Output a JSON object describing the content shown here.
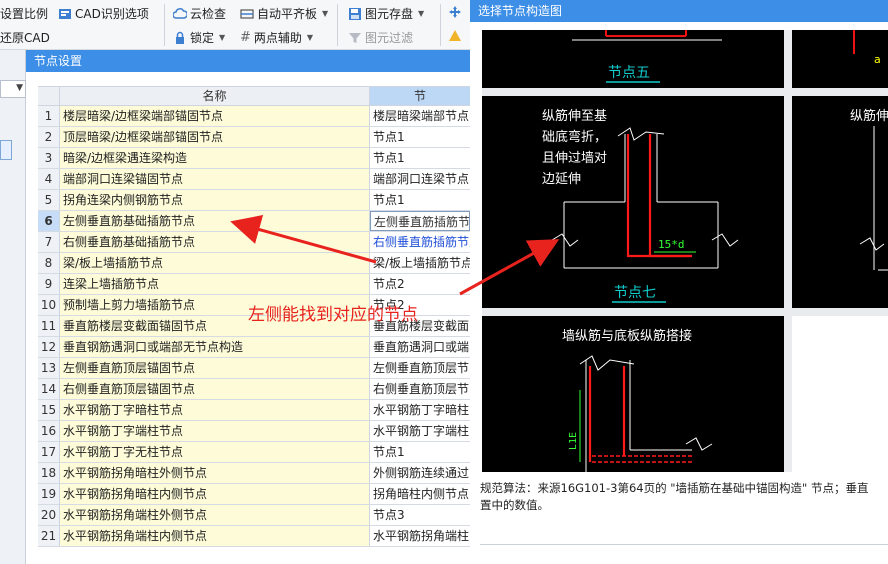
{
  "ribbon": {
    "set_ratio": "设置比例",
    "cad_identify": "CAD识别选项",
    "restore_cad": "还原CAD",
    "cloud_check": "云检查",
    "lock": "锁定",
    "auto_align": "自动平齐板",
    "two_point_aux": "两点辅助",
    "save_element": "图元存盘",
    "element_filter": "图元过滤"
  },
  "node_dialog": {
    "title": "节点设置",
    "col_name": "名称",
    "col_value": "节",
    "rows": [
      {
        "num": "1",
        "name": "楼层暗梁/边框梁端部锚固节点",
        "value": "楼层暗梁端部节点"
      },
      {
        "num": "2",
        "name": "顶层暗梁/边框梁端部锚固节点",
        "value": "节点1"
      },
      {
        "num": "3",
        "name": "暗梁/边框梁遇连梁构造",
        "value": "节点1"
      },
      {
        "num": "4",
        "name": "端部洞口连梁锚固节点",
        "value": "端部洞口连梁节点"
      },
      {
        "num": "5",
        "name": "拐角连梁内侧钢筋节点",
        "value": "节点1"
      },
      {
        "num": "6",
        "name": "左侧垂直筋基础插筋节点",
        "value": "左侧垂直筋插筋节点"
      },
      {
        "num": "7",
        "name": "右侧垂直筋基础插筋节点",
        "value": "右侧垂直筋插筋节点"
      },
      {
        "num": "8",
        "name": "梁/板上墙插筋节点",
        "value": "梁/板上墙插筋节点"
      },
      {
        "num": "9",
        "name": "连梁上墙插筋节点",
        "value": "节点2"
      },
      {
        "num": "10",
        "name": "预制墙上剪力墙插筋节点",
        "value": "节点2"
      },
      {
        "num": "11",
        "name": "垂直筋楼层变截面锚固节点",
        "value": "垂直筋楼层变截面"
      },
      {
        "num": "12",
        "name": "垂直钢筋遇洞口或端部无节点构造",
        "value": "垂直筋遇洞口或端"
      },
      {
        "num": "13",
        "name": "左侧垂直筋顶层锚固节点",
        "value": "左侧垂直筋顶层节"
      },
      {
        "num": "14",
        "name": "右侧垂直筋顶层锚固节点",
        "value": "右侧垂直筋顶层节"
      },
      {
        "num": "15",
        "name": "水平钢筋丁字暗柱节点",
        "value": "水平钢筋丁字暗柱"
      },
      {
        "num": "16",
        "name": "水平钢筋丁字端柱节点",
        "value": "水平钢筋丁字端柱"
      },
      {
        "num": "17",
        "name": "水平钢筋丁字无柱节点",
        "value": "节点1"
      },
      {
        "num": "18",
        "name": "水平钢筋拐角暗柱外侧节点",
        "value": "外侧钢筋连续通过"
      },
      {
        "num": "19",
        "name": "水平钢筋拐角暗柱内侧节点",
        "value": "拐角暗柱内侧节点"
      },
      {
        "num": "20",
        "name": "水平钢筋拐角端柱外侧节点",
        "value": "节点3"
      },
      {
        "num": "21",
        "name": "水平钢筋拐角端柱内侧节点",
        "value": "水平钢筋拐角端柱"
      }
    ]
  },
  "picker": {
    "title": "选择节点构造图",
    "thumbs": {
      "node5_label": "节点五",
      "node7_label": "节点七",
      "node7_caption": [
        "纵筋伸至基",
        "础底弯折，",
        "且伸过墙对",
        "边延伸"
      ],
      "node7_dim": "15*d",
      "node8_caption": "纵筋伸",
      "node9_caption": "墙纵筋与底板纵筋搭接",
      "node9_dim": "L1E",
      "corner_mark": "a"
    },
    "description_line1": "规范算法：来源16G101-3第64页的 \"墙插筋在基础中锚固构造\" 节点；垂直",
    "description_line2": "置中的数值。"
  },
  "annotation": {
    "text": "左侧能找到对应的节点",
    "color": "#e8231e"
  }
}
